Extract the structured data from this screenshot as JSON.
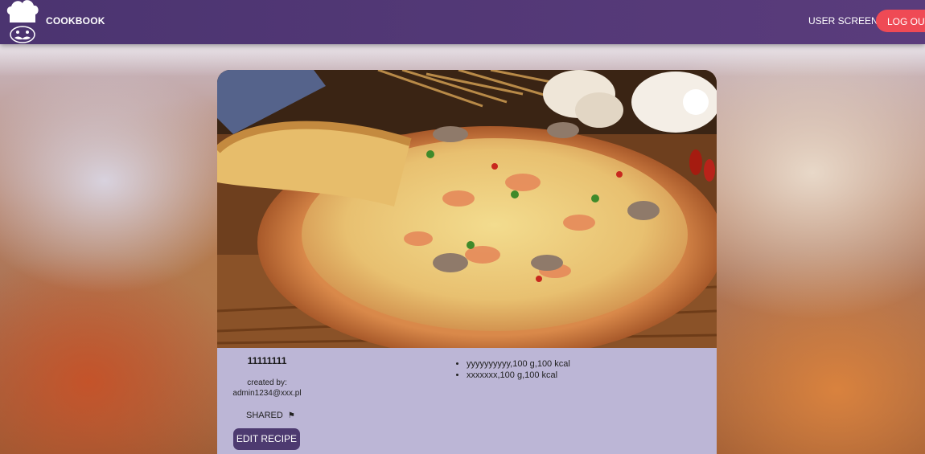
{
  "header": {
    "brand": "COOKBOOK",
    "nav_user_screen": "USER SCREEN",
    "nav_logout": "LOG OUT",
    "logo_icon": "chef-hat-icon"
  },
  "recipe": {
    "title": "11111111",
    "created_label": "created by:",
    "author": "admin1234@xxx.pl",
    "shared_label": "SHARED",
    "shared_icon": "flag-icon",
    "edit_label": "EDIT RECIPE",
    "ingredients": [
      "yyyyyyyyyy,100 g,100 kcal",
      "xxxxxxx,100 g,100 kcal"
    ]
  },
  "colors": {
    "header": "#4b3470",
    "logout": "#ef4a55",
    "edit_button": "#4d3a70",
    "details_panel": "#bcb6d6"
  }
}
